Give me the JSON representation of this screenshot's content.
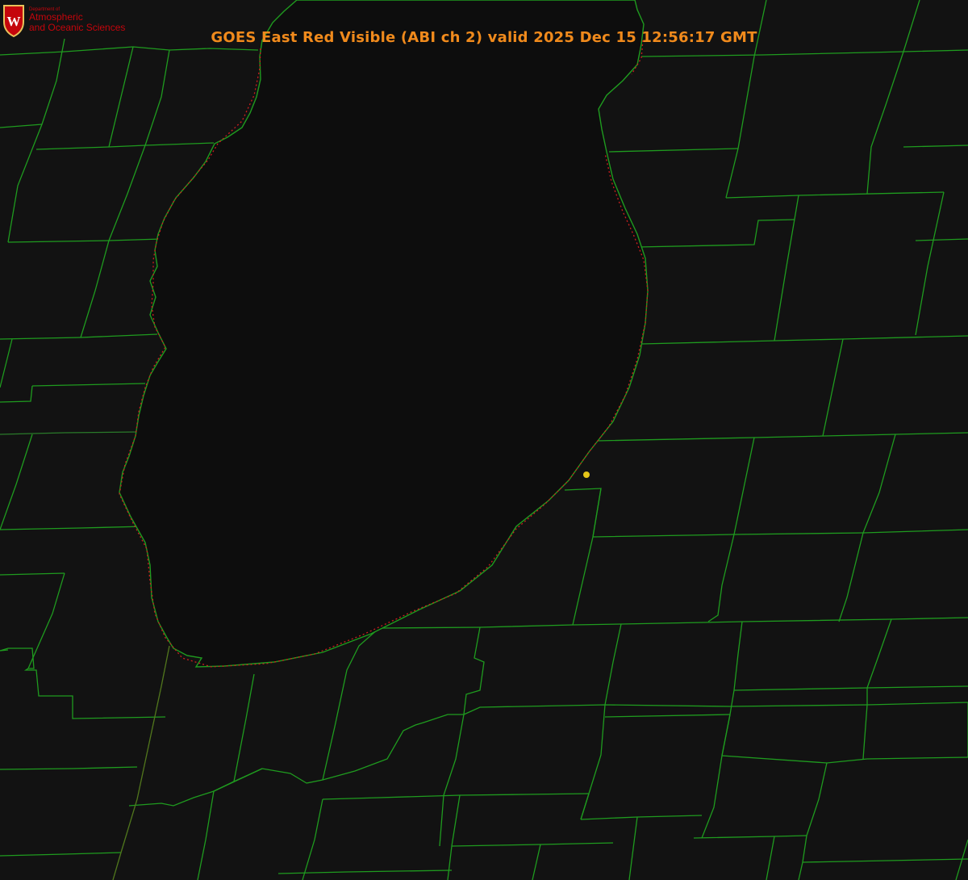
{
  "image": {
    "title": "GOES East Red Visible (ABI ch 2) valid 2025 Dec 15 12:56:17 GMT",
    "colors": {
      "background": "#121212",
      "county_lines": "#1f9b1f",
      "coastline": "#cc1f1f",
      "marker": "#e6c619",
      "title": "#f08a1c",
      "logo": "#c5050c"
    }
  },
  "logo": {
    "crest_letter": "W",
    "dept": "Department of",
    "line1": "Atmospheric",
    "line2": "and Oceanic Sciences"
  },
  "map": {
    "feature": "lake",
    "marker_icon": "location-dot-icon"
  }
}
